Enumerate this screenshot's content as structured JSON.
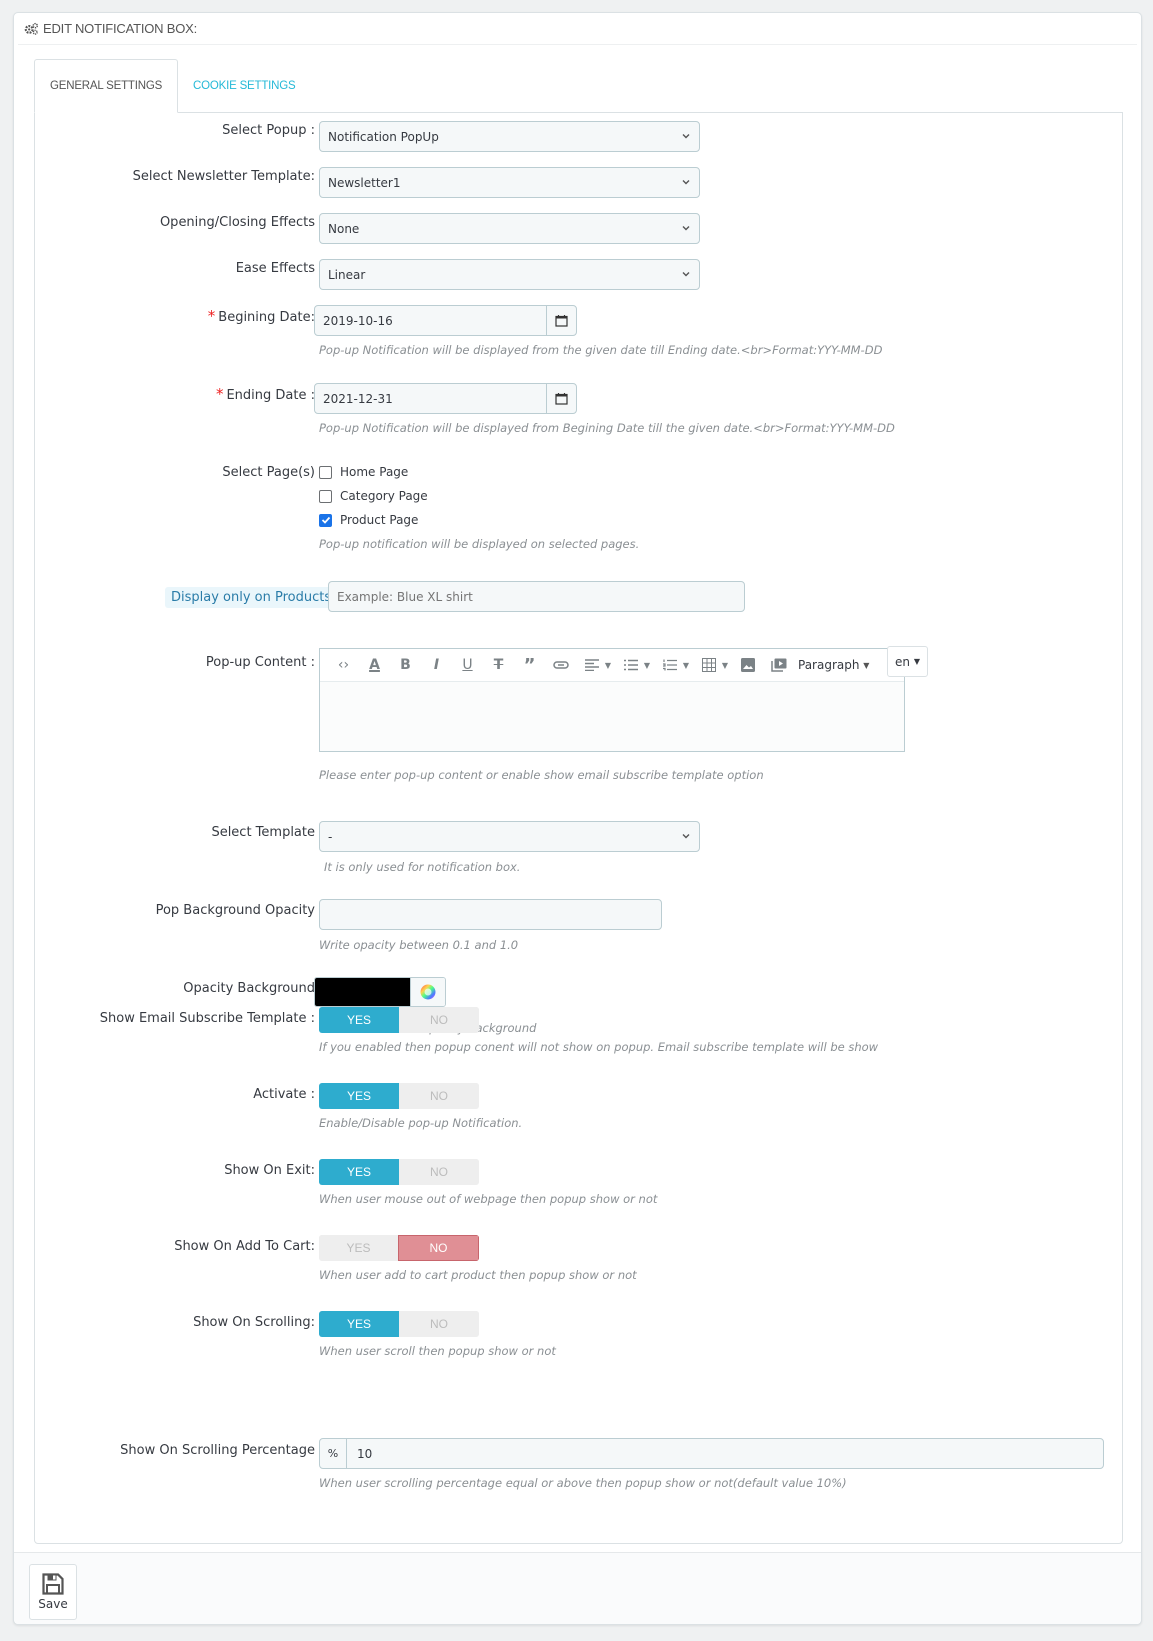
{
  "panel": {
    "title": "EDIT NOTIFICATION BOX:",
    "icon": "gears-icon"
  },
  "tabs": [
    {
      "label": "GENERAL SETTINGS",
      "active": true
    },
    {
      "label": "COOKIE SETTINGS",
      "active": false
    }
  ],
  "form": {
    "select_popup": {
      "label": "Select Popup :",
      "value": "Notification PopUp"
    },
    "select_newsletter": {
      "label": "Select Newsletter Template:",
      "value": "Newsletter1"
    },
    "opening_effects": {
      "label": "Opening/Closing Effects",
      "value": "None"
    },
    "ease_effects": {
      "label": "Ease Effects",
      "value": "Linear"
    },
    "begin_date": {
      "required": "*",
      "label": "Begining Date:",
      "value": "2019-10-16",
      "help": "Pop-up Notification will be displayed from the given date till Ending date.<br>Format:YYY-MM-DD",
      "icon": "calendar-icon"
    },
    "end_date": {
      "required": "*",
      "label": "Ending Date :",
      "value": "2021-12-31",
      "help": "Pop-up Notification will be displayed from Begining Date till the given date.<br>Format:YYY-MM-DD",
      "icon": "calendar-icon"
    },
    "pages": {
      "label": "Select Page(s)",
      "options": [
        {
          "label": "Home Page",
          "checked": false
        },
        {
          "label": "Category Page",
          "checked": false
        },
        {
          "label": "Product Page",
          "checked": true
        }
      ],
      "help": "Pop-up notification will be displayed on selected pages."
    },
    "products": {
      "label": "Display only on Products",
      "placeholder": "Example: Blue XL shirt",
      "value": ""
    },
    "content": {
      "label": "Pop-up Content :",
      "toolbar": [
        "code",
        "text-color",
        "bold",
        "italic",
        "underline",
        "strikethrough",
        "blockquote",
        "link",
        "align",
        "bullet-list",
        "numbered-list",
        "table",
        "image",
        "media"
      ],
      "format": "Paragraph",
      "language": "en",
      "help": "Please enter pop-up content or enable show email subscribe template option"
    },
    "select_template": {
      "label": "Select Template",
      "value": "-",
      "help": "It is only used for notification box."
    },
    "bg_opacity": {
      "label": "Pop Background Opacity",
      "value": "",
      "help": "Write opacity between 0.1 and 1.0"
    },
    "opacity_background": {
      "label": "Opacity Background",
      "color": "#000000",
      "help": "This color is used opacity background"
    },
    "switches": [
      {
        "key": "email_template",
        "label": "Show Email Subscribe Template :",
        "yes": "YES",
        "no": "NO",
        "value": "yes",
        "help": "If you enabled then popup conent will not show on popup. Email subscribe template will be show"
      },
      {
        "key": "activate",
        "label": "Activate :",
        "yes": "YES",
        "no": "NO",
        "value": "yes",
        "help": "Enable/Disable pop-up Notification."
      },
      {
        "key": "show_on_exit",
        "label": "Show On Exit:",
        "yes": "YES",
        "no": "NO",
        "value": "yes",
        "help": "When user mouse out of webpage then popup show or not"
      },
      {
        "key": "add_to_cart",
        "label": "Show On Add To Cart:",
        "yes": "YES",
        "no": "NO",
        "value": "no",
        "help": "When user add to cart product then popup show or not"
      },
      {
        "key": "scrolling",
        "label": "Show On Scrolling:",
        "yes": "YES",
        "no": "NO",
        "value": "yes",
        "help": "When user scroll then popup show or not"
      }
    ],
    "scroll_percentage": {
      "label": "Show On Scrolling Percentage",
      "prefix": "%",
      "value": "10",
      "help": "When user scrolling percentage equal or above then popup show or not(default value 10%)"
    }
  },
  "footer": {
    "save_label": "Save",
    "save_icon": "floppy-disk-icon"
  },
  "colors": {
    "accent": "#25b9d7",
    "switch_on": "#2eacce",
    "switch_no_on": "#e08f95",
    "required": "#e22222"
  }
}
